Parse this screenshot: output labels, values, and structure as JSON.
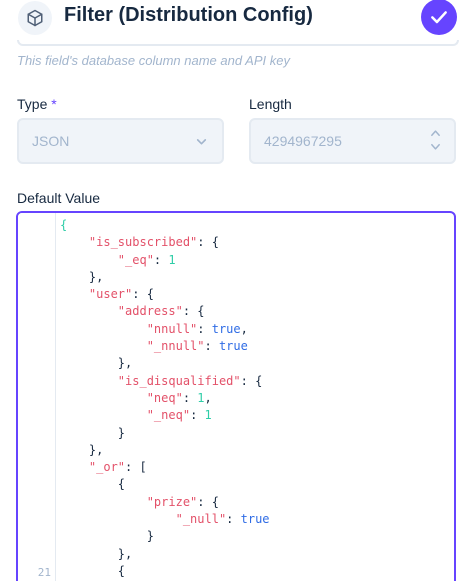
{
  "header": {
    "icon": "box-icon",
    "title": "Filter (Distribution Config)",
    "save_icon": "check-icon"
  },
  "hint": "This field's database column name and API key",
  "type_field": {
    "label": "Type",
    "required_mark": "*",
    "value": "JSON",
    "icon": "chevron-down-icon"
  },
  "length_field": {
    "label": "Length",
    "value": "4294967295",
    "icon": "stepper-icon"
  },
  "default_value": {
    "label": "Default Value",
    "visible_line_number": "21",
    "lines": [
      [
        {
          "t": "{",
          "c": "tok-brace-first"
        }
      ],
      [
        {
          "t": "    "
        },
        {
          "t": "\"is_subscribed\"",
          "c": "tok-key"
        },
        {
          "t": ": {"
        }
      ],
      [
        {
          "t": "        "
        },
        {
          "t": "\"_eq\"",
          "c": "tok-key"
        },
        {
          "t": ": "
        },
        {
          "t": "1",
          "c": "tok-num"
        }
      ],
      [
        {
          "t": "    },"
        }
      ],
      [
        {
          "t": "    "
        },
        {
          "t": "\"user\"",
          "c": "tok-key"
        },
        {
          "t": ": {"
        }
      ],
      [
        {
          "t": "        "
        },
        {
          "t": "\"address\"",
          "c": "tok-key"
        },
        {
          "t": ": {"
        }
      ],
      [
        {
          "t": "            "
        },
        {
          "t": "\"nnull\"",
          "c": "tok-key"
        },
        {
          "t": ": "
        },
        {
          "t": "true",
          "c": "tok-bool"
        },
        {
          "t": ","
        }
      ],
      [
        {
          "t": "            "
        },
        {
          "t": "\"_nnull\"",
          "c": "tok-key"
        },
        {
          "t": ": "
        },
        {
          "t": "true",
          "c": "tok-bool"
        }
      ],
      [
        {
          "t": "        },"
        }
      ],
      [
        {
          "t": "        "
        },
        {
          "t": "\"is_disqualified\"",
          "c": "tok-key"
        },
        {
          "t": ": {"
        }
      ],
      [
        {
          "t": "            "
        },
        {
          "t": "\"neq\"",
          "c": "tok-key"
        },
        {
          "t": ": "
        },
        {
          "t": "1",
          "c": "tok-num"
        },
        {
          "t": ","
        }
      ],
      [
        {
          "t": "            "
        },
        {
          "t": "\"_neq\"",
          "c": "tok-key"
        },
        {
          "t": ": "
        },
        {
          "t": "1",
          "c": "tok-num"
        }
      ],
      [
        {
          "t": "        }"
        }
      ],
      [
        {
          "t": "    },"
        }
      ],
      [
        {
          "t": "    "
        },
        {
          "t": "\"_or\"",
          "c": "tok-key"
        },
        {
          "t": ": ["
        }
      ],
      [
        {
          "t": "        {"
        }
      ],
      [
        {
          "t": "            "
        },
        {
          "t": "\"prize\"",
          "c": "tok-key"
        },
        {
          "t": ": {"
        }
      ],
      [
        {
          "t": "                "
        },
        {
          "t": "\"_null\"",
          "c": "tok-key"
        },
        {
          "t": ": "
        },
        {
          "t": "true",
          "c": "tok-bool"
        }
      ],
      [
        {
          "t": "            }"
        }
      ],
      [
        {
          "t": "        },"
        }
      ],
      [
        {
          "t": "        {"
        }
      ]
    ]
  }
}
